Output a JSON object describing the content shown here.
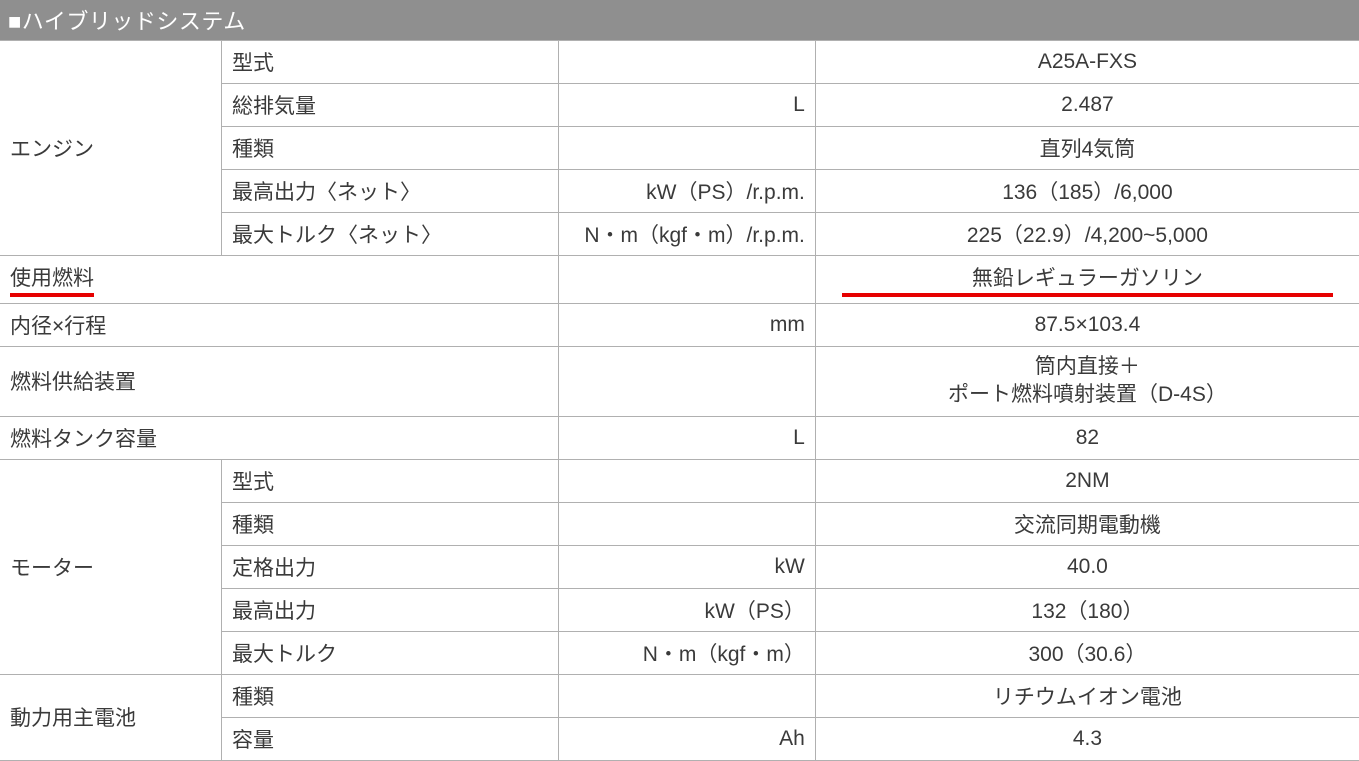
{
  "header": "■ハイブリッドシステム",
  "groups": {
    "engine": {
      "label": "エンジン",
      "rows": [
        {
          "name": "型式",
          "unit": "",
          "value": "A25A-FXS"
        },
        {
          "name": "総排気量",
          "unit": "L",
          "value": "2.487"
        },
        {
          "name": "種類",
          "unit": "",
          "value": "直列4気筒"
        },
        {
          "name": "最高出力〈ネット〉",
          "unit": "kW（PS）/r.p.m.",
          "value": "136（185）/6,000"
        },
        {
          "name": "最大トルク〈ネット〉",
          "unit": "N・m（kgf・m）/r.p.m.",
          "value": "225（22.9）/4,200~5,000"
        }
      ]
    },
    "fuel_type": {
      "label": "使用燃料",
      "unit": "",
      "value": "無鉛レギュラーガソリン"
    },
    "bore_stroke": {
      "label": "内径×行程",
      "unit": "mm",
      "value": "87.5×103.4"
    },
    "fuel_supply": {
      "label": "燃料供給装置",
      "unit": "",
      "value": "筒内直接＋\nポート燃料噴射装置（D-4S）"
    },
    "tank": {
      "label": "燃料タンク容量",
      "unit": "L",
      "value": "82"
    },
    "motor": {
      "label": "モーター",
      "rows": [
        {
          "name": "型式",
          "unit": "",
          "value": "2NM"
        },
        {
          "name": "種類",
          "unit": "",
          "value": "交流同期電動機"
        },
        {
          "name": "定格出力",
          "unit": "kW",
          "value": "40.0"
        },
        {
          "name": "最高出力",
          "unit": "kW（PS）",
          "value": "132（180）"
        },
        {
          "name": "最大トルク",
          "unit": "N・m（kgf・m）",
          "value": "300（30.6）"
        }
      ]
    },
    "battery": {
      "label": "動力用主電池",
      "rows": [
        {
          "name": "種類",
          "unit": "",
          "value": "リチウムイオン電池"
        },
        {
          "name": "容量",
          "unit": "Ah",
          "value": "4.3"
        }
      ]
    }
  }
}
